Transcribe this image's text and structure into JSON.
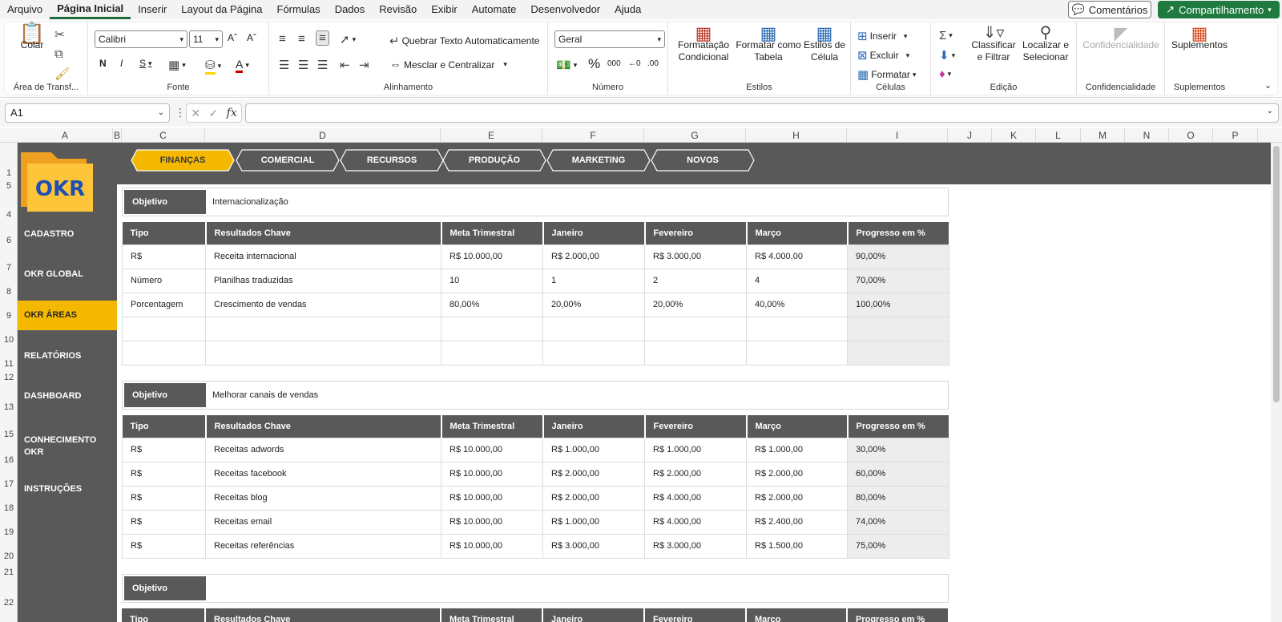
{
  "menu": {
    "items": [
      "Arquivo",
      "Página Inicial",
      "Inserir",
      "Layout da Página",
      "Fórmulas",
      "Dados",
      "Revisão",
      "Exibir",
      "Automate",
      "Desenvolvedor",
      "Ajuda"
    ],
    "active": "Página Inicial",
    "comments_label": "Comentários",
    "share_label": "Compartilhamento"
  },
  "ribbon": {
    "clipboard": {
      "paste": "Colar",
      "group": "Área de Transf..."
    },
    "font": {
      "name": "Calibri",
      "size": "11",
      "bold": "N",
      "italic": "I",
      "underline": "S",
      "group": "Fonte"
    },
    "alignment": {
      "wrap": "Quebrar Texto Automaticamente",
      "merge": "Mesclar e Centralizar",
      "group": "Alinhamento"
    },
    "number": {
      "format": "Geral",
      "group": "Número"
    },
    "styles": {
      "conditional": "Formatação Condicional",
      "table": "Formatar como Tabela",
      "cell": "Estilos de Célula",
      "group": "Estilos"
    },
    "cells": {
      "insert": "Inserir",
      "delete": "Excluir",
      "format": "Formatar",
      "group": "Células"
    },
    "editing": {
      "sort": "Classificar e Filtrar",
      "find": "Localizar e Selecionar",
      "group": "Edição"
    },
    "sensitivity": {
      "label": "Confidencialidade",
      "group": "Confidencialidade"
    },
    "addins": {
      "label": "Suplementos",
      "group": "Suplementos"
    }
  },
  "formula_bar": {
    "cell_ref": "A1",
    "fx": "fx"
  },
  "columns": [
    "A",
    "B",
    "C",
    "D",
    "E",
    "F",
    "G",
    "H",
    "I",
    "J",
    "K",
    "L",
    "M",
    "N",
    "O",
    "P"
  ],
  "rows": [
    "1",
    "5",
    "4",
    "6",
    "7",
    "8",
    "9",
    "10",
    "11",
    "12",
    "13",
    "15",
    "16",
    "17",
    "18",
    "19",
    "20",
    "21",
    "22"
  ],
  "logo_text": "OKR",
  "tabs": [
    {
      "label": "FINANÇAS",
      "active": true
    },
    {
      "label": "COMERCIAL",
      "active": false
    },
    {
      "label": "RECURSOS",
      "active": false
    },
    {
      "label": "PRODUÇÃO",
      "active": false
    },
    {
      "label": "MARKETING",
      "active": false
    },
    {
      "label": "NOVOS",
      "active": false
    }
  ],
  "sidebar": [
    {
      "label": "CADASTRO",
      "active": false
    },
    {
      "label": "OKR GLOBAL",
      "active": false
    },
    {
      "label": "OKR ÁREAS",
      "active": true
    },
    {
      "label": "RELATÓRIOS",
      "active": false
    },
    {
      "label": "DASHBOARD",
      "active": false
    },
    {
      "label": "CONHECIMENTO OKR",
      "active": false
    },
    {
      "label": "INSTRUÇÕES",
      "active": false
    }
  ],
  "objective_label": "Objetivo",
  "headers": [
    "Tipo",
    "Resultados Chave",
    "Meta Trimestral",
    "Janeiro",
    "Fevereiro",
    "Março",
    "Progresso em %"
  ],
  "objectives": [
    {
      "title": "Internacionalização",
      "rows": [
        [
          "R$",
          "Receita internacional",
          "R$ 10.000,00",
          "R$ 2.000,00",
          "R$ 3.000,00",
          "R$ 4.000,00",
          "90,00%"
        ],
        [
          "Número",
          "Planilhas traduzidas",
          "10",
          "1",
          "2",
          "4",
          "70,00%"
        ],
        [
          "Porcentagem",
          "Crescimento de vendas",
          "80,00%",
          "20,00%",
          "20,00%",
          "40,00%",
          "100,00%"
        ],
        [
          "",
          "",
          "",
          "",
          "",
          "",
          ""
        ],
        [
          "",
          "",
          "",
          "",
          "",
          "",
          ""
        ]
      ]
    },
    {
      "title": "Melhorar canais de vendas",
      "rows": [
        [
          "R$",
          "Receitas adwords",
          "R$ 10.000,00",
          "R$ 1.000,00",
          "R$ 1.000,00",
          "R$ 1.000,00",
          "30,00%"
        ],
        [
          "R$",
          "Receitas facebook",
          "R$ 10.000,00",
          "R$ 2.000,00",
          "R$ 2.000,00",
          "R$ 2.000,00",
          "60,00%"
        ],
        [
          "R$",
          "Receitas blog",
          "R$ 10.000,00",
          "R$ 2.000,00",
          "R$ 4.000,00",
          "R$ 2.000,00",
          "80,00%"
        ],
        [
          "R$",
          "Receitas email",
          "R$ 10.000,00",
          "R$ 1.000,00",
          "R$ 4.000,00",
          "R$ 2.400,00",
          "74,00%"
        ],
        [
          "R$",
          "Receitas referências",
          "R$ 10.000,00",
          "R$ 3.000,00",
          "R$ 3.000,00",
          "R$ 1.500,00",
          "75,00%"
        ]
      ]
    },
    {
      "title": "",
      "rows": []
    }
  ]
}
